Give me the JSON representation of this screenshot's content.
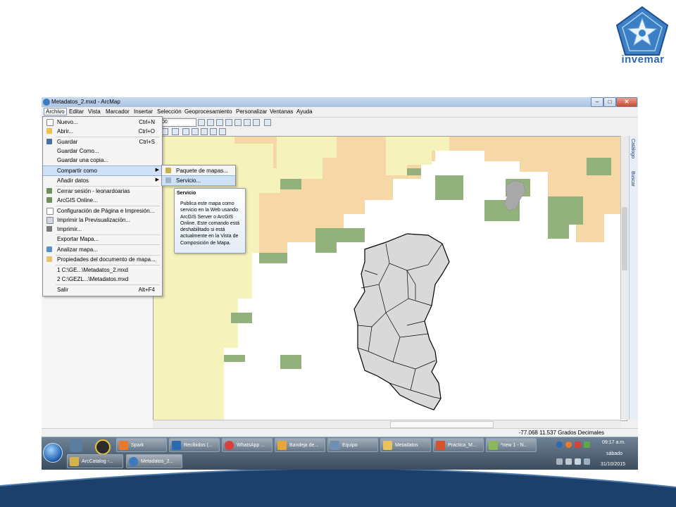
{
  "logo": {
    "text": "invemar"
  },
  "app": {
    "title": "Metadatos_2.mxd - ArcMap",
    "window_buttons": [
      "–",
      "□",
      "✕"
    ]
  },
  "menubar": [
    "Archivo",
    "Editar",
    "Vista",
    "Marcador",
    "Insertar",
    "Selección",
    "Geoprocesamiento",
    "Personalizar",
    "Ventanas",
    "Ayuda"
  ],
  "toolbar": {
    "scale_value": "00"
  },
  "archivo_menu": {
    "nuevo": {
      "label": "Nuevo...",
      "shortcut": "Ctrl+N"
    },
    "abrir": {
      "label": "Abrir...",
      "shortcut": "Ctrl+O"
    },
    "guardar": {
      "label": "Guardar",
      "shortcut": "Ctrl+S"
    },
    "guardar_como": {
      "label": "Guardar Como..."
    },
    "guardar_copia": {
      "label": "Guardar una copia..."
    },
    "compartir": {
      "label": "Compartir como"
    },
    "anadir": {
      "label": "Añadir datos"
    },
    "cerrar_sesion": {
      "label": "Cerrar sesión - leonardoarias"
    },
    "arcgis_online": {
      "label": "ArcGIS Online..."
    },
    "config_pagina": {
      "label": "Configuración de Página e Impresión..."
    },
    "imprimir_previa": {
      "label": "Imprimir la Previsualización..."
    },
    "imprimir": {
      "label": "Imprimir..."
    },
    "exportar": {
      "label": "Exportar Mapa..."
    },
    "analizar": {
      "label": "Analizar mapa..."
    },
    "propiedades": {
      "label": "Propiedades del documento de mapa..."
    },
    "recent1": {
      "label": "1 C:\\GE...\\Metadatos_2.mxd"
    },
    "recent2": {
      "label": "2 C:\\GEZL...\\Metadatos.mxd"
    },
    "salir": {
      "label": "Salir",
      "shortcut": "Alt+F4"
    }
  },
  "submenu": {
    "paquete": "Paquete de mapas...",
    "servicio": "Servicio..."
  },
  "tooltip": {
    "title": "Servicio",
    "lines": [
      "Publica este mapa como",
      "servicio en la Web usando",
      "ArcGIS Server o ArcGIS",
      "Online. Este comando está",
      "deshabilitado si está",
      "actualmente en la Vista de",
      "Composición de Mapa."
    ]
  },
  "right_tabs": [
    "Catálogo",
    "Buscar"
  ],
  "status": {
    "coords": "-77.068  11.537 Grados Decimales"
  },
  "taskbar": {
    "buttons": [
      "Spark",
      "Recibidos (...",
      "WhatsApp ...",
      "Bandeja de...",
      "Equipo",
      "Metadatos",
      "Practica_M...",
      "*new  1 - N...",
      "ArcCatalog -...",
      "Metadatos_2..."
    ],
    "time": "09:17 a.m.",
    "day": "sábado",
    "date": "31/10/2015"
  },
  "colors": {
    "sand": "#f5d8a6",
    "pale_yellow": "#f6f2bc",
    "green": "#93b17c",
    "gray_region": "#a9a9a9",
    "municipios": "#d9d9d9",
    "bottom_band": "#1c3f6b"
  }
}
